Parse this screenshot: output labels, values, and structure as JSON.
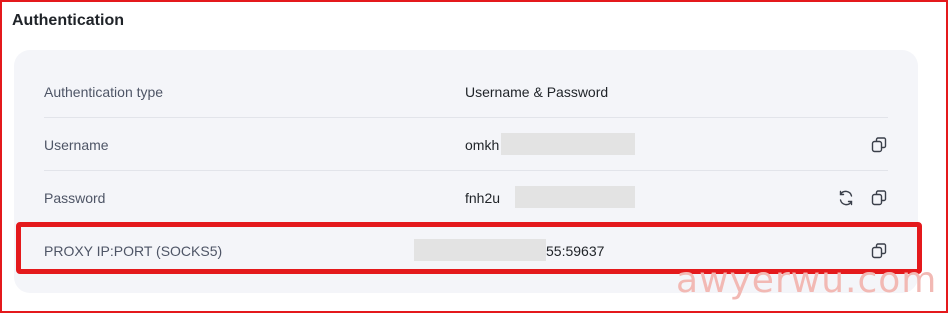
{
  "section": {
    "title": "Authentication"
  },
  "rows": [
    {
      "label": "Authentication type",
      "value": "Username & Password"
    },
    {
      "label": "Username",
      "value": "omkh"
    },
    {
      "label": "Password",
      "value": "fnh2u"
    },
    {
      "label": "PROXY IP:PORT (SOCKS5)",
      "value": "55:59637"
    }
  ],
  "icons": {
    "copy": "copy-icon",
    "refresh": "refresh-icon"
  },
  "watermark": "awyerwu.com",
  "colors": {
    "highlight": "#e4191c",
    "panel_bg": "#f4f5f9"
  }
}
